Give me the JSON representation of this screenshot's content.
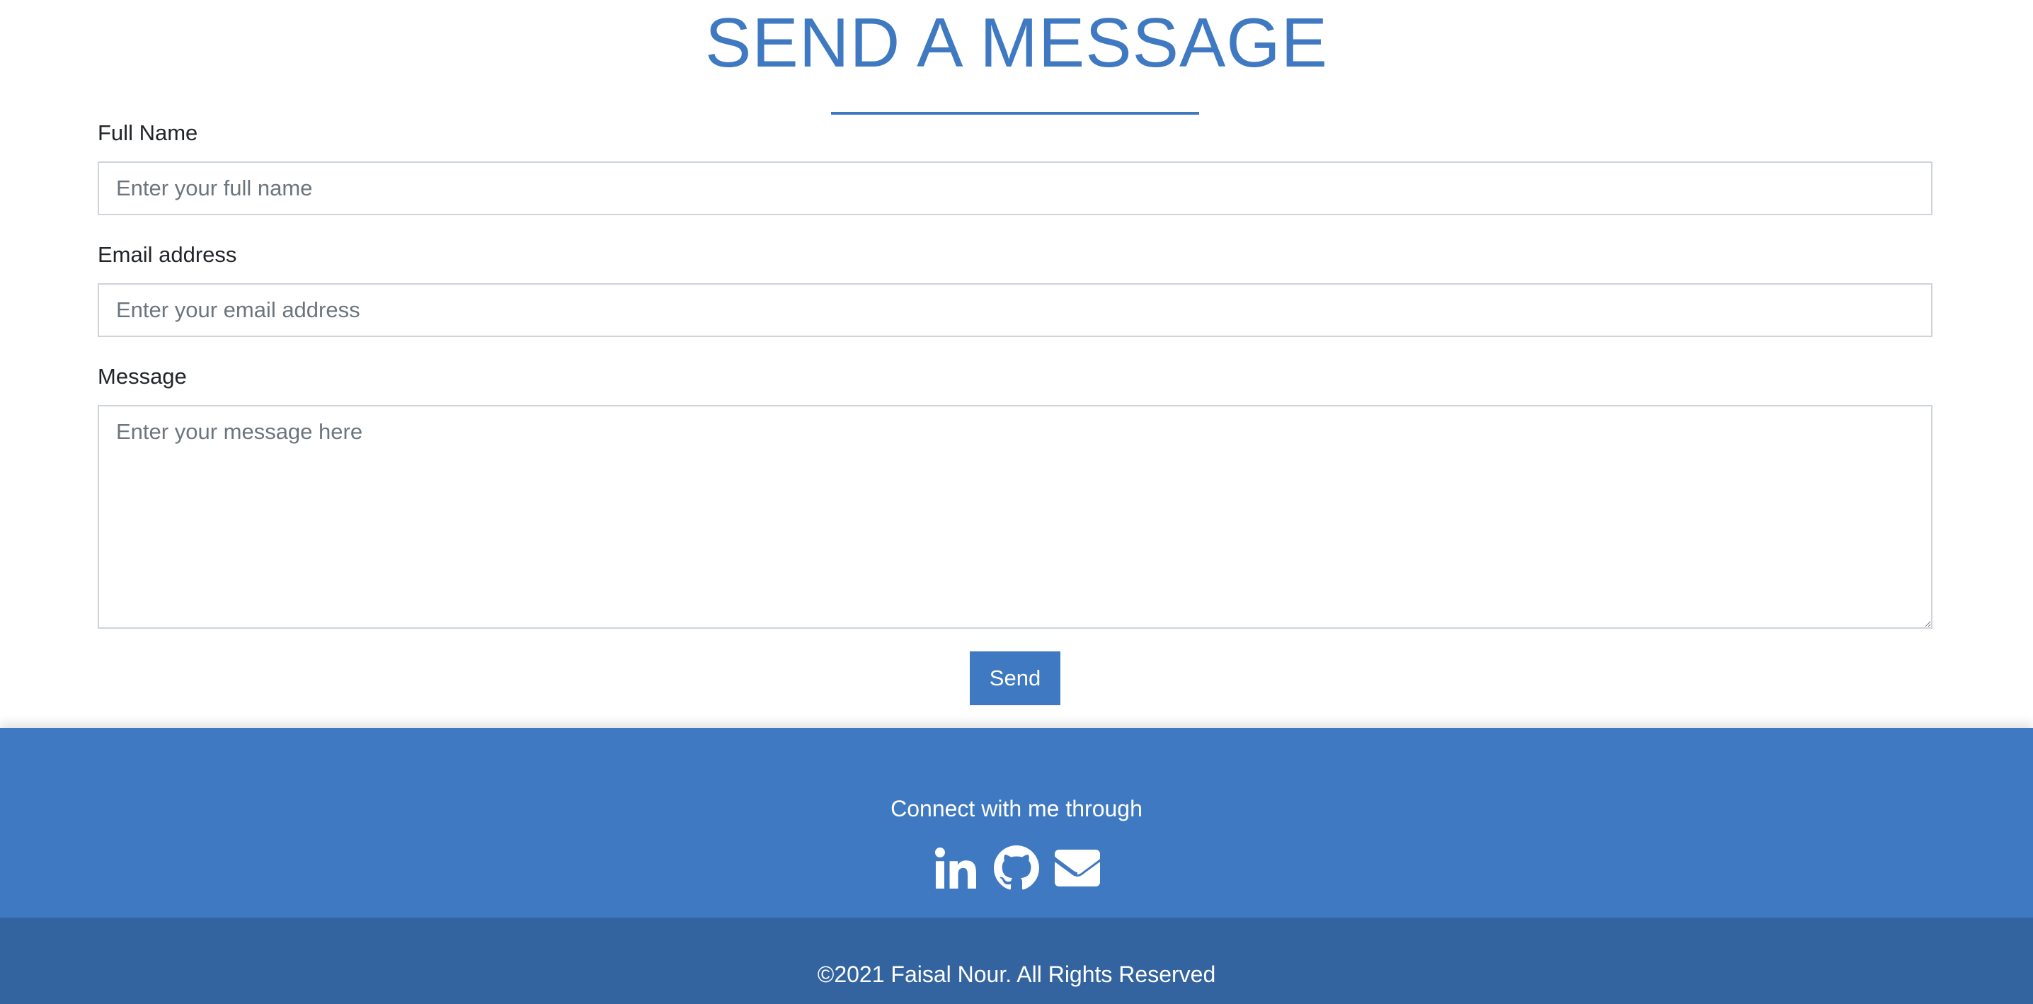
{
  "contact": {
    "title": "SEND A MESSAGE",
    "full_name": {
      "label": "Full Name",
      "placeholder": "Enter your full name",
      "value": ""
    },
    "email": {
      "label": "Email address",
      "placeholder": "Enter your email address",
      "value": ""
    },
    "message": {
      "label": "Message",
      "placeholder": "Enter your message here",
      "value": ""
    },
    "send_label": "Send"
  },
  "footer": {
    "connect_text": "Connect with me through",
    "social_icons": [
      "linkedin-icon",
      "github-icon",
      "envelope-icon"
    ],
    "copyright": "©2021 Faisal Nour. All Rights Reserved"
  },
  "colors": {
    "accent": "#3f79c2",
    "footer_dark": "#3464a0",
    "text": "#212529",
    "placeholder": "#6c757d",
    "input_border": "#ced4da"
  }
}
